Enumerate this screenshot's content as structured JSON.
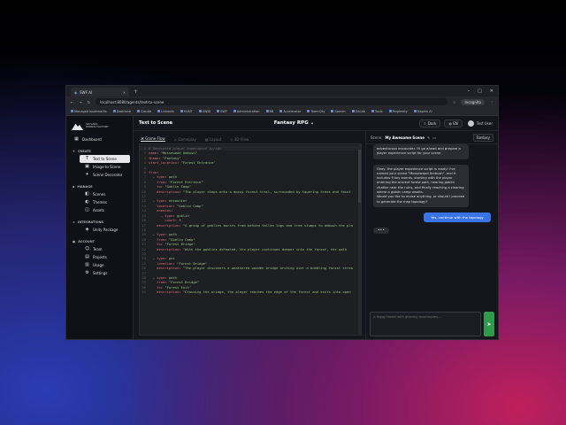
{
  "browser": {
    "tab_title": "SWF AI",
    "url": "localhost:8080/agents/text-to-scene",
    "incognito": "Incognito",
    "bookmarks": [
      "Managed bookmarks",
      "Dashlane",
      "Claude",
      "LinkedIn",
      "HUNT",
      "SWID",
      "SWF",
      "Administration",
      "BB",
      "Accelerator",
      "TeamCity",
      "Swarm",
      "GitLab",
      "Tools",
      "Perplexity",
      "Napkin AI"
    ]
  },
  "brand": {
    "line1": "SKYLARK",
    "line2": "WORKS FACTORY"
  },
  "sidebar": {
    "dashboard": "Dashboard",
    "create_label": "CREATE",
    "create_items": [
      "Text to Scene",
      "Image to Scene",
      "Scene Decorator"
    ],
    "manage_label": "MANAGE",
    "manage_items": [
      "Scenes",
      "Themes",
      "Assets"
    ],
    "integrations_label": "INTEGRATIONS",
    "integrations_items": [
      "Unity Package"
    ],
    "account_label": "ACCOUNT",
    "account_items": [
      "Team",
      "Projects",
      "Usage",
      "Settings"
    ]
  },
  "header": {
    "title": "Text to Scene",
    "project": "Fantasy RPG",
    "theme": "Dark",
    "lang": "EN",
    "user": "Test User"
  },
  "editor": {
    "tabs": [
      "Game Flow",
      "Gameplay",
      "Layout",
      "3D View"
    ],
    "lines": [
      "# Generated player experience script",
      "name: \"Mossewood Ambush\"",
      "theme: \"Fantasy\"",
      "start_location: \"Forest Entrance\"",
      "",
      "flow:",
      "  - type: path",
      "    from: \"Forest Entrance\"",
      "    to: \"Goblin Camp\"",
      "    description: \"The player steps onto a mossy forest trail, surrounded by towering trees and faint",
      "",
      "  - type: encounter",
      "    location: \"Goblin Camp\"",
      "    enemies:",
      "      - type: goblin",
      "        count: 3",
      "    description: \"A group of goblins bursts from behind fallen logs and tree stumps to ambush the pla",
      "",
      "  - type: path",
      "    from: \"Goblin Camp\"",
      "    to: \"Forest Bridge\"",
      "    description: \"With the goblins defeated, the player continues deeper into the forest, the path",
      "",
      "  - type: poi",
      "    location: \"Forest Bridge\"",
      "    description: \"The player discovers a weathered wooden bridge arching over a bubbling forest strea",
      "",
      "  - type: path",
      "    from: \"Forest Bridge\"",
      "    to: \"Forest Exit\"",
      "    description: \"Crossing the bridge, the player reaches the edge of the forest and exits into open"
    ]
  },
  "chat": {
    "scene_label": "Scene:",
    "scene_name": "My Awesome Scene",
    "theme_badge": "Fantasy",
    "msg1": "adventurous encounter. I'll go ahead and prepare a player experience script for your scene.",
    "msg2": "Okay, the player experience script is ready! I've named your scene \"Mossewood Ambush\", and it includes 9 key events, starting with the player entering the ancient forest path, hearing goblin chatter near the ruins, and finally reaching a clearing where a goblin camp awaits.",
    "msg2b": "Would you like to revise anything, or should I proceed to generate the map topology?",
    "user_msg": "Yes, continue with the topology",
    "typing": "•••",
    "input_placeholder": "A foggy forest with glowing mushrooms..."
  },
  "colors": {
    "accent": "#3874e6",
    "send": "#2f9a4a"
  }
}
